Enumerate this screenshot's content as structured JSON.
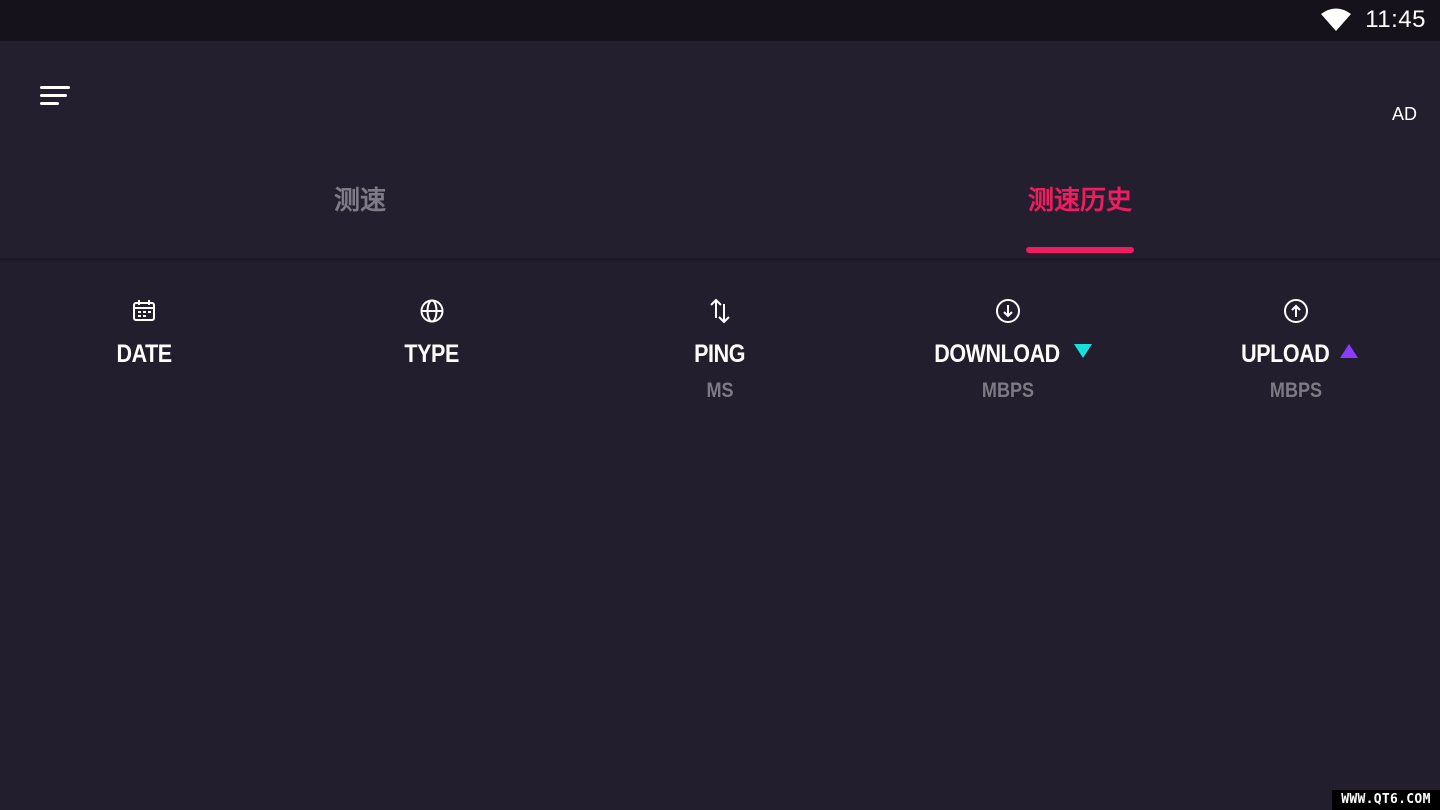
{
  "status_bar": {
    "time": "11:45",
    "wifi_icon": "wifi-icon"
  },
  "header": {
    "menu_icon": "menu-icon",
    "ad_label": "AD"
  },
  "tabs": [
    {
      "label": "测速",
      "active": false
    },
    {
      "label": "测速历史",
      "active": true
    }
  ],
  "colors": {
    "accent": "#ef1d60",
    "background": "#231e2e",
    "status_bar": "#15121b",
    "download_marker": "#17e0dc",
    "upload_marker": "#8b3dff",
    "muted_text": "#7d7985"
  },
  "history_columns": [
    {
      "icon": "calendar-icon",
      "label": "DATE",
      "unit": ""
    },
    {
      "icon": "globe-icon",
      "label": "TYPE",
      "unit": ""
    },
    {
      "icon": "ping-arrows-icon",
      "label": "PING",
      "unit": "MS"
    },
    {
      "icon": "download-circle-icon",
      "label": "DOWNLOAD",
      "unit": "MBPS",
      "marker": "down-triangle-icon"
    },
    {
      "icon": "upload-circle-icon",
      "label": "UPLOAD",
      "unit": "MBPS",
      "marker": "up-triangle-icon"
    }
  ],
  "watermark": "WWW.QT6.COM"
}
